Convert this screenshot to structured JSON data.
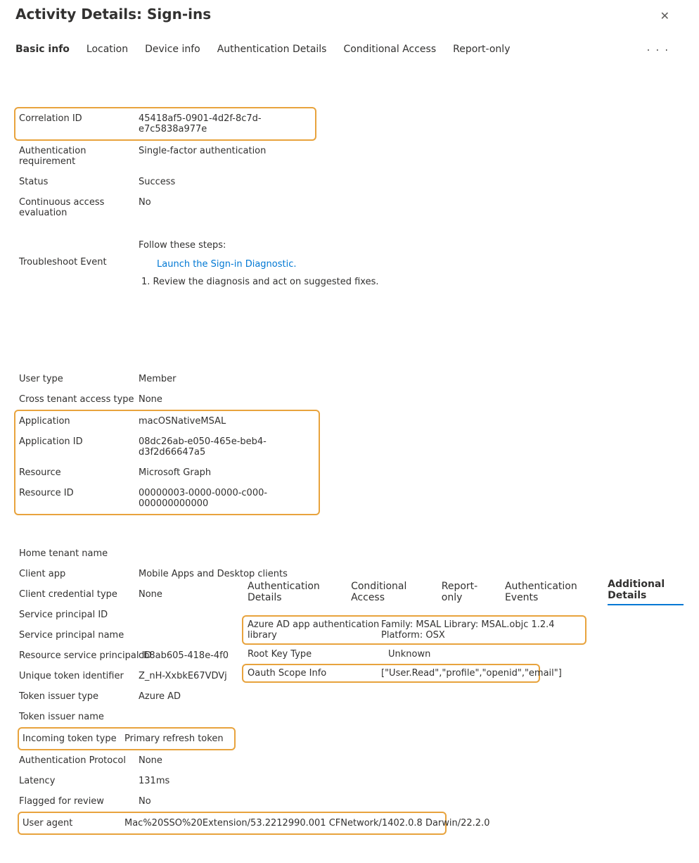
{
  "title": "Activity Details: Sign-ins",
  "tabs": {
    "items": [
      "Basic info",
      "Location",
      "Device info",
      "Authentication Details",
      "Conditional Access",
      "Report-only"
    ],
    "more": "· · ·"
  },
  "group1": {
    "corr_label": "Correlation ID",
    "corr_value": "45418af5-0901-4d2f-8c7d-e7c5838a977e",
    "auth_req_label": "Authentication requirement",
    "auth_req_value": "Single-factor authentication",
    "status_label": "Status",
    "status_value": "Success",
    "cae_label": "Continuous access evaluation",
    "cae_value": "No"
  },
  "troubleshoot": {
    "label": "Troubleshoot Event",
    "follow": "Follow these steps:",
    "launch": "Launch the Sign-in Diagnostic.",
    "step": "Review the diagnosis and act on suggested fixes."
  },
  "group2": {
    "user_type_label": "User type",
    "user_type_value": "Member",
    "cross_label": "Cross tenant access type",
    "cross_value": "None",
    "app_label": "Application",
    "app_value": "macOSNativeMSAL",
    "appid_label": "Application ID",
    "appid_value": "08dc26ab-e050-465e-beb4-d3f2d66647a5",
    "resource_label": "Resource",
    "resource_value": "Microsoft Graph",
    "resourceid_label": "Resource ID",
    "resourceid_value": "00000003-0000-0000-c000-000000000000"
  },
  "group3": {
    "home_label": "Home tenant name",
    "home_value": "",
    "client_label": "Client app",
    "client_value": "Mobile Apps and Desktop clients",
    "cred_label": "Client credential type",
    "cred_value": "None",
    "spid_label": "Service principal ID",
    "spid_value": "",
    "spname_label": "Service principal name",
    "spname_value": "",
    "rspid_label": "Resource service principal ID",
    "rspid_value": "cb8ab605-418e-4f0",
    "utid_label": "Unique token identifier",
    "utid_value": "Z_nH-XxbkE67VDVj",
    "tit_label": "Token issuer type",
    "tit_value": "Azure AD",
    "tin_label": "Token issuer name",
    "tin_value": "",
    "inc_label": "Incoming token type",
    "inc_value": "Primary refresh token",
    "ap_label": "Authentication Protocol",
    "ap_value": "None",
    "lat_label": "Latency",
    "lat_value": "131ms",
    "flag_label": "Flagged for review",
    "flag_value": "No",
    "ua_label": "User agent",
    "ua_value": "Mac%20SSO%20Extension/53.2212990.001 CFNetwork/1402.0.8 Darwin/22.2.0"
  },
  "extra_tabs": [
    "Authentication Details",
    "Conditional Access",
    "Report-only",
    "Authentication Events",
    "Additional Details"
  ],
  "extra": {
    "lib_label": "Azure AD app authentication library",
    "lib_value": "Family: MSAL Library: MSAL.objc 1.2.4 Platform: OSX",
    "rkt_label": "Root Key Type",
    "rkt_value": "Unknown",
    "oauth_label": "Oauth Scope Info",
    "oauth_value": "[\"User.Read\",\"profile\",\"openid\",\"email\"]"
  }
}
